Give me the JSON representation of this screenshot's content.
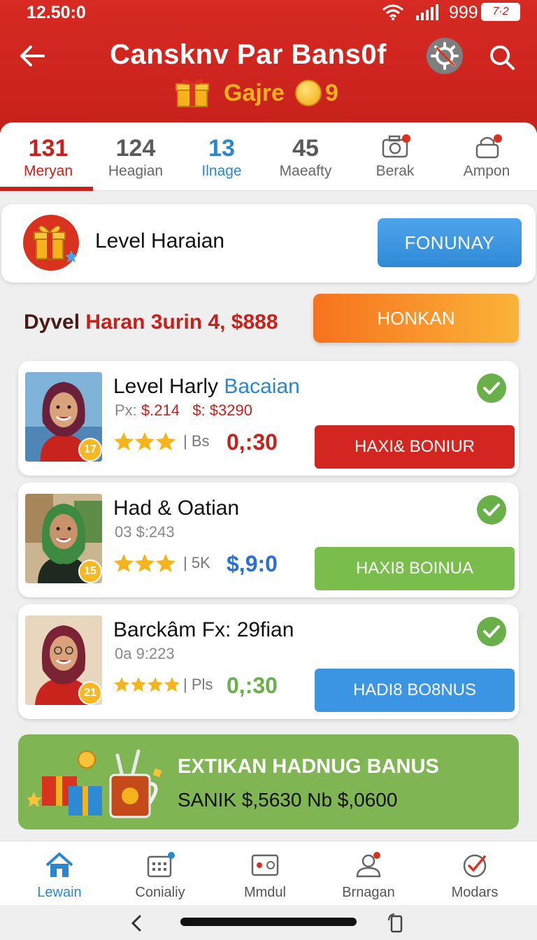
{
  "status_bar": {
    "time": "12.50:0",
    "battery_text": "999",
    "battery_label": "7·2"
  },
  "header": {
    "title": "Cansknv Par Bans0f",
    "subtitle": "Gajre",
    "subtitle_number": "9"
  },
  "tabs": [
    {
      "number": "131",
      "label": "Meryan",
      "active": true
    },
    {
      "number": "124",
      "label": "Heagian"
    },
    {
      "number": "13",
      "label": "Ilnage"
    },
    {
      "number": "45",
      "label": "Maeafty"
    },
    {
      "icon": "camera-icon",
      "label": "Berak"
    },
    {
      "icon": "lock-icon",
      "label": "Ampon"
    }
  ],
  "level_card": {
    "name": "Level Haraian",
    "button": "FONUNAY"
  },
  "daily": {
    "prefix": "Dyvel",
    "text": "Haran 3urin 4, $888",
    "button": "HONKAN"
  },
  "items": [
    {
      "title": "Level Harly",
      "title_accent": "Bacaian",
      "sub_prefix": "Px:",
      "sub_value1": "$.214",
      "sub_value2": "$: $3290",
      "badge": "17",
      "sep": "| Bs",
      "value": "0,:30",
      "value_color": "#c8211b",
      "action": "HAXI& BONIUR"
    },
    {
      "title": "Had & Oatian",
      "title_accent": "",
      "sub_prefix": "03 $:243",
      "sub_value1": "",
      "sub_value2": "",
      "badge": "15",
      "sep": "| 5K",
      "value": "$,9:0",
      "value_color": "#2b6fd0",
      "action": "HAXI8 BOINUA"
    },
    {
      "title": "Barckâm Fx: 29fian",
      "title_accent": "",
      "sub_prefix": "0a 9:223",
      "sub_value1": "",
      "sub_value2": "",
      "badge": "21",
      "sep": "| Pls",
      "value": "0,:30",
      "value_color": "#6ab04a",
      "action": "HADI8 BO8NUS"
    }
  ],
  "bonus": {
    "title": "EXTIKAN HADNUG BANUS",
    "line": "SANIK $,5630  Nb $,0600"
  },
  "bottom_nav": [
    {
      "icon": "home-icon",
      "label": "Lewain",
      "active": true
    },
    {
      "icon": "calendar-icon",
      "label": "Conialiy"
    },
    {
      "icon": "card-icon",
      "label": "Mmdul"
    },
    {
      "icon": "user-icon",
      "label": "Brnagan"
    },
    {
      "icon": "badge-icon",
      "label": "Modars"
    }
  ],
  "colors": {
    "brand_red": "#c8211b",
    "accent_blue": "#2b86d0",
    "accent_green": "#79bd4c",
    "accent_orange": "#f7721d"
  }
}
